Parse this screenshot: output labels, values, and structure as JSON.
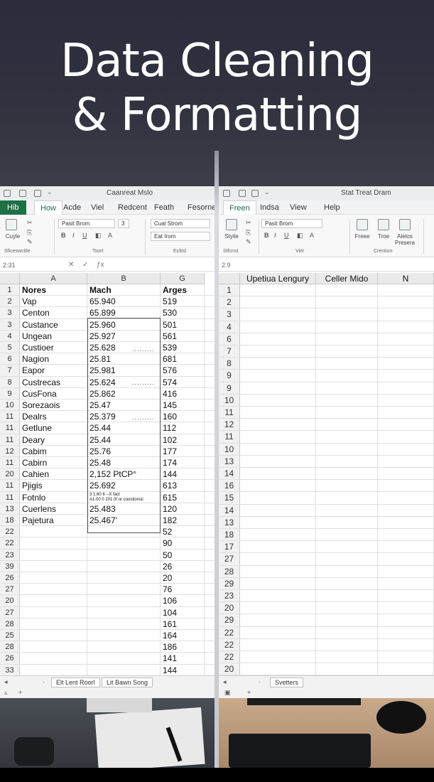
{
  "title": {
    "line1": "Data Cleaning",
    "line2": "& Formatting"
  },
  "left": {
    "app_title": "Caanreat Mslo",
    "tabs": [
      "Hib",
      "How",
      "Acde",
      "Viel",
      "Redcent",
      "Feath",
      "Fesorne"
    ],
    "ribbon": {
      "paste_label": "Cuyle",
      "font_name": "Pasit Brom",
      "font_size": "3",
      "style_box": "Cual Strom",
      "style_box2": "Eat Irom",
      "group_labels": [
        "Sficeswcitle",
        "Toort",
        "Eclitsl"
      ]
    },
    "namebox": "2:31",
    "columns": [
      "A",
      "B",
      "G"
    ],
    "rows": [
      {
        "n": "1",
        "a": "Nores",
        "b": "Mach",
        "c": "Arges",
        "hdr": true
      },
      {
        "n": "2",
        "a": "Vap",
        "b": "65.940",
        "c": "519"
      },
      {
        "n": "3",
        "a": "Centon",
        "b": "65.899",
        "c": "530"
      },
      {
        "n": "3",
        "a": "Custance",
        "b": "25.960",
        "c": "501"
      },
      {
        "n": "4",
        "a": "Ungean",
        "b": "25.927",
        "c": "561"
      },
      {
        "n": "5",
        "a": "Custioer",
        "b": "25.628",
        "c": "539"
      },
      {
        "n": "6",
        "a": "Nagion",
        "b": "25.81",
        "c": "681"
      },
      {
        "n": "7",
        "a": "Eapor",
        "b": "25.981",
        "c": "576"
      },
      {
        "n": "8",
        "a": "Custrecas",
        "b": "25.624",
        "c": "574"
      },
      {
        "n": "9",
        "a": "CusFona",
        "b": "25.862",
        "c": "416"
      },
      {
        "n": "10",
        "a": "Sorezaois",
        "b": "25.47",
        "c": "145"
      },
      {
        "n": "11",
        "a": "Dealrs",
        "b": "25.379",
        "c": "160"
      },
      {
        "n": "11",
        "a": "Getlune",
        "b": "25.44",
        "c": "112"
      },
      {
        "n": "11",
        "a": "Deary",
        "b": "25.44",
        "c": "102"
      },
      {
        "n": "12",
        "a": "Cabim",
        "b": "25.76",
        "c": "177"
      },
      {
        "n": "11",
        "a": "Cabirn",
        "b": "25.48",
        "c": "174"
      },
      {
        "n": "20",
        "a": "Cahien",
        "b": "2,152 PtCP°",
        "c": "144"
      },
      {
        "n": "11",
        "a": "Pjigis",
        "b": "25.692",
        "c": "613"
      },
      {
        "n": "11",
        "a": "Fotnlo",
        "b": "3 1.60 6 --X fact\nA1.00 0 201.0f or coostionsii",
        "c": "615",
        "tiny": true
      },
      {
        "n": "13",
        "a": "Cuerlens",
        "b": "25.483",
        "c": "120"
      },
      {
        "n": "18",
        "a": "Pajetura",
        "b": "25.467'",
        "c": "182"
      },
      {
        "n": "22",
        "a": "",
        "b": "",
        "c": "52"
      },
      {
        "n": "22",
        "a": "",
        "b": "",
        "c": "90"
      },
      {
        "n": "23",
        "a": "",
        "b": "",
        "c": "50"
      },
      {
        "n": "39",
        "a": "",
        "b": "",
        "c": "26"
      },
      {
        "n": "26",
        "a": "",
        "b": "",
        "c": "20"
      },
      {
        "n": "27",
        "a": "",
        "b": "",
        "c": "76"
      },
      {
        "n": "20",
        "a": "",
        "b": "",
        "c": "106"
      },
      {
        "n": "27",
        "a": "",
        "b": "",
        "c": "104"
      },
      {
        "n": "28",
        "a": "",
        "b": "",
        "c": "161"
      },
      {
        "n": "25",
        "a": "",
        "b": "",
        "c": "164"
      },
      {
        "n": "28",
        "a": "",
        "b": "",
        "c": "186"
      },
      {
        "n": "26",
        "a": "",
        "b": "",
        "c": "141"
      },
      {
        "n": "33",
        "a": "",
        "b": "",
        "c": "144"
      }
    ],
    "sheet_tabs": [
      "Elt Lent Roorl",
      "Lit Bawn Song"
    ]
  },
  "right": {
    "app_title": "Stat Treat Dram",
    "tabs": [
      "Freen",
      "Indsa",
      "View",
      "Help"
    ],
    "ribbon": {
      "paste_label": "Styile",
      "font_name": "Pasit Brom",
      "buttons": [
        "Freee",
        "Troe",
        "Alelos Presera"
      ],
      "group_labels": [
        "Stfcnst",
        "Vier",
        "Crention"
      ]
    },
    "namebox": "2.9",
    "headers": [
      "Upetiua Lengury",
      "Celler Mido",
      "N"
    ],
    "row_numbers": [
      "1",
      "2",
      "3",
      "4",
      "6",
      "7",
      "8",
      "9",
      "9",
      "10",
      "11",
      "12",
      "11",
      "10",
      "13",
      "14",
      "16",
      "15",
      "14",
      "13",
      "18",
      "17",
      "27",
      "28",
      "29",
      "23",
      "20",
      "29",
      "22",
      "22",
      "22",
      "20"
    ],
    "sheet_tab": "Svetters"
  }
}
